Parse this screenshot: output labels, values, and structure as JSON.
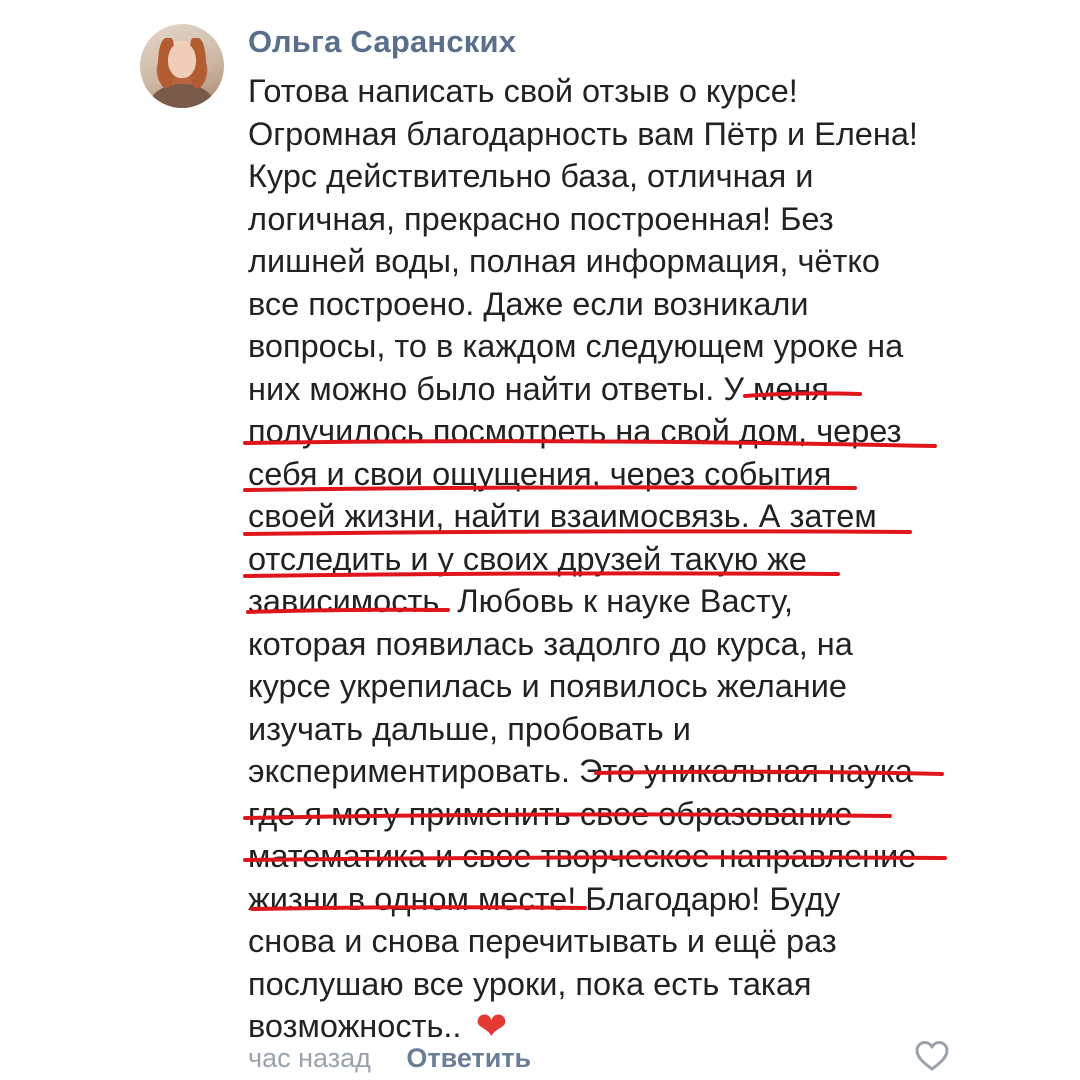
{
  "comment": {
    "author": "Ольга Саранских",
    "lines": [
      "Готова написать свой отзыв о курсе!",
      "Огромная благодарность вам Пётр и Елена!",
      "Курс действительно база, отличная и",
      "логичная, прекрасно построенная! Без",
      "лишней воды, полная информация, чётко",
      "все построено. Даже если возникали",
      "вопросы, то в каждом следующем уроке на",
      "них можно было  найти ответы. У меня",
      "получилось посмотреть на свой дом, через",
      "себя и свои ощущения, через события",
      "своей жизни, найти взаимосвязь. А затем",
      "отследить и у своих друзей такую же",
      "зависимость. Любовь к науке Васту,",
      "которая появилась задолго до курса, на",
      "курсе укрепилась и появилось желание",
      "изучать дальше, пробовать и",
      "экспериментировать. Это уникальная наука",
      "где я могу применить свое образование",
      "математика и свое творческое направление",
      "жизни в одном месте! Благодарю! Буду",
      "снова и снова перечитывать и ещё раз",
      "послушаю все уроки, пока есть такая",
      "возможность.."
    ],
    "emoji": "❤",
    "timestamp": "час назад",
    "reply_label": "Ответить"
  },
  "colors": {
    "author": "#5a6f8c",
    "text": "#222222",
    "underline": "#e0141b",
    "meta": "#9aa3ad",
    "reply": "#6a7f97"
  },
  "icons": [
    "avatar-photo",
    "heart-emoji",
    "like-heart-outline-icon"
  ]
}
